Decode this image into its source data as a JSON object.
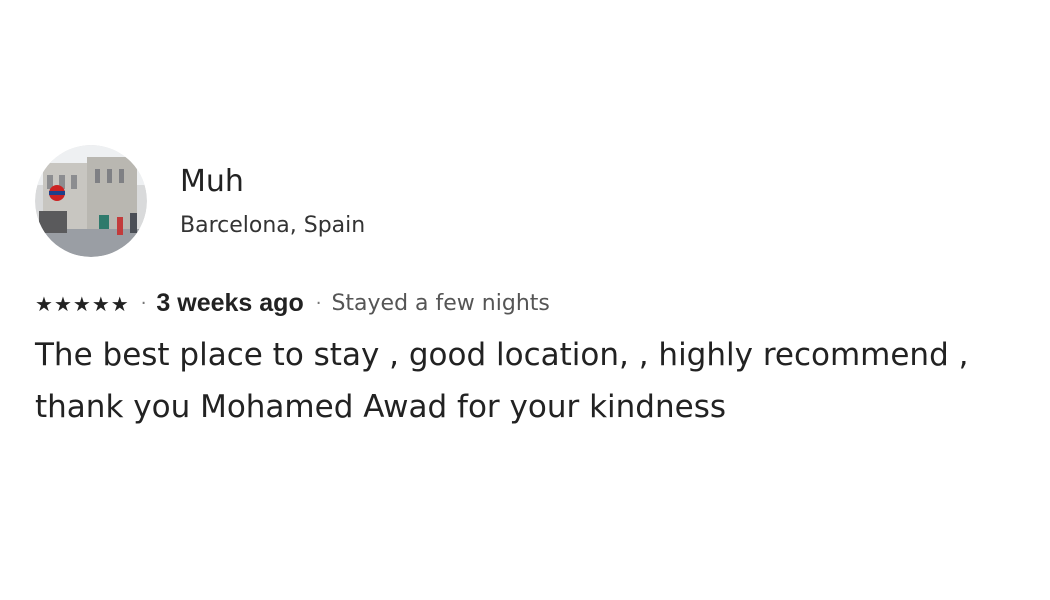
{
  "review": {
    "reviewer_name": "Muh",
    "reviewer_location": "Barcelona, Spain",
    "rating_stars": 5,
    "rating_max": 5,
    "time_ago": "3 weeks ago",
    "stay_info": "Stayed a few nights",
    "separator": "·",
    "text": "The best place to stay , good location, , highly recommend , thank you Mohamed Awad for your kindness"
  },
  "icons": {
    "star": "star-icon",
    "avatar": "user-avatar-photo"
  },
  "colors": {
    "text_primary": "#222222",
    "text_secondary": "#555555",
    "background": "#ffffff"
  }
}
